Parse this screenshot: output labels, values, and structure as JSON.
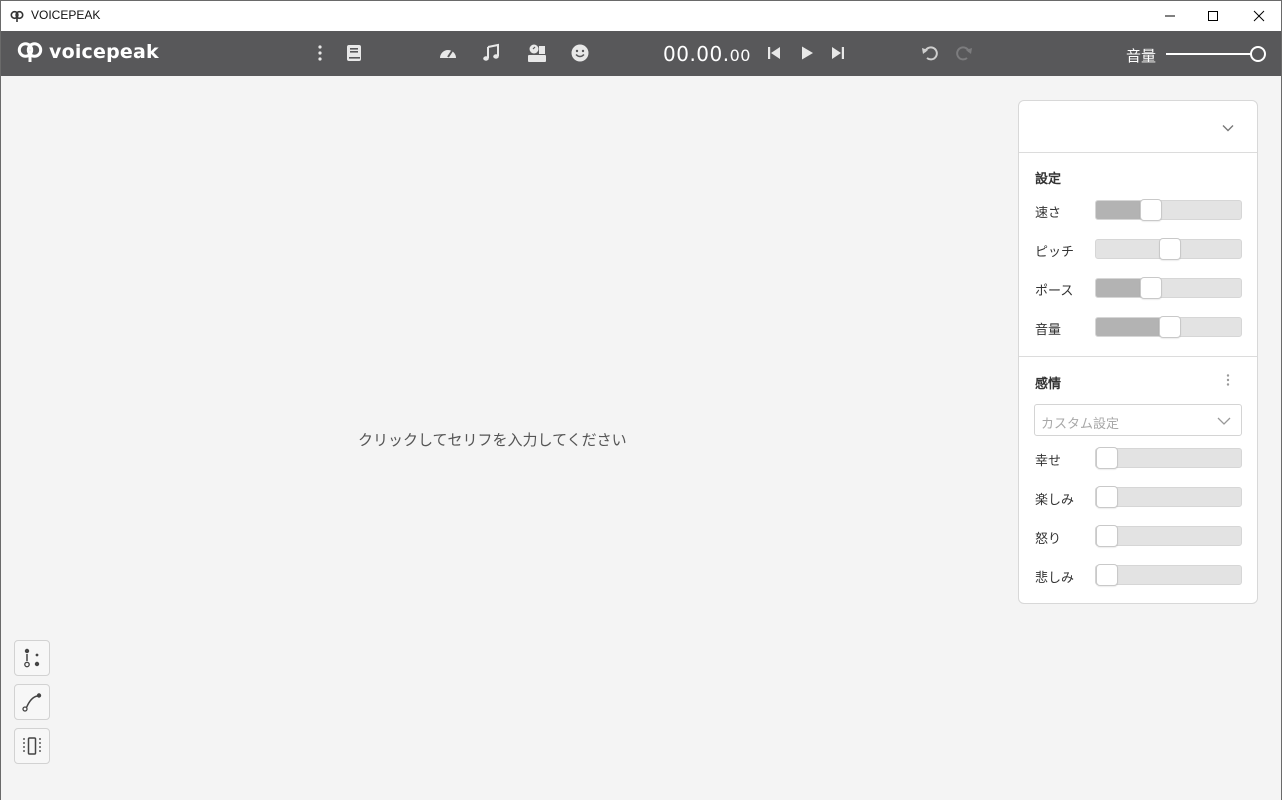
{
  "window": {
    "title": "VOICEPEAK",
    "icons": [
      "voicepeak-icon",
      "minimize-icon",
      "maximize-icon",
      "close-icon"
    ]
  },
  "toolbar": {
    "logo_text": "voicepeak",
    "icons": [
      "kebab-menu-icon",
      "dictionary-icon",
      "speed-icon",
      "music-note-icon",
      "speaker-settings-icon",
      "emotion-icon",
      "skip-back-icon",
      "play-icon",
      "skip-forward-icon",
      "undo-icon",
      "redo-icon"
    ],
    "timecode_main": "00.00.",
    "timecode_small": "00",
    "volume_label": "音量",
    "volume_level": 1.0
  },
  "editor": {
    "placeholder": "クリックしてセリフを入力してください"
  },
  "panel": {
    "settings_title": "設定",
    "settings": [
      {
        "label": "速さ",
        "value": 0.35
      },
      {
        "label": "ピッチ",
        "value": 0.5
      },
      {
        "label": "ポース",
        "value": 0.35
      },
      {
        "label": "音量",
        "value": 0.5
      }
    ],
    "emotion_title": "感情",
    "emotion_preset": "カスタム設定",
    "emotions": [
      {
        "label": "幸せ",
        "value": 0
      },
      {
        "label": "楽しみ",
        "value": 0
      },
      {
        "label": "怒り",
        "value": 0
      },
      {
        "label": "悲しみ",
        "value": 0
      }
    ]
  },
  "tools": [
    "phoneme-tool-icon",
    "curve-tool-icon",
    "range-tool-icon"
  ],
  "colors": {
    "toolbar_bg": "#58585a",
    "content_bg": "#f4f4f4",
    "slider_fill": "#b3b3b3"
  }
}
